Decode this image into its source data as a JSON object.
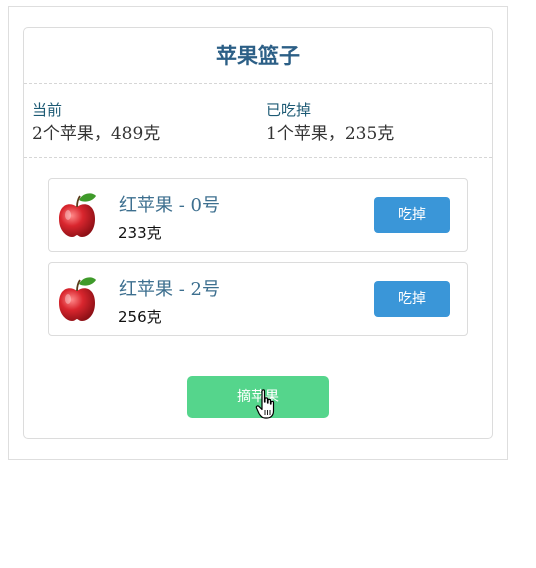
{
  "basket": {
    "title": "苹果篮子",
    "current": {
      "label": "当前",
      "value": "2个苹果，489克"
    },
    "eaten": {
      "label": "已吃掉",
      "value": "1个苹果，235克"
    }
  },
  "apples": [
    {
      "name": "红苹果 - 0号",
      "weight": "233克",
      "eat_label": "吃掉",
      "icon": "apple-icon"
    },
    {
      "name": "红苹果 - 2号",
      "weight": "256克",
      "eat_label": "吃掉",
      "icon": "apple-icon"
    }
  ],
  "pick_button": {
    "label": "摘苹果"
  },
  "colors": {
    "title": "#2c5f86",
    "eat_button": "#3a96d8",
    "pick_button": "#55d58c",
    "apple_red": "#d9262e",
    "leaf_green": "#3f9a2a"
  }
}
